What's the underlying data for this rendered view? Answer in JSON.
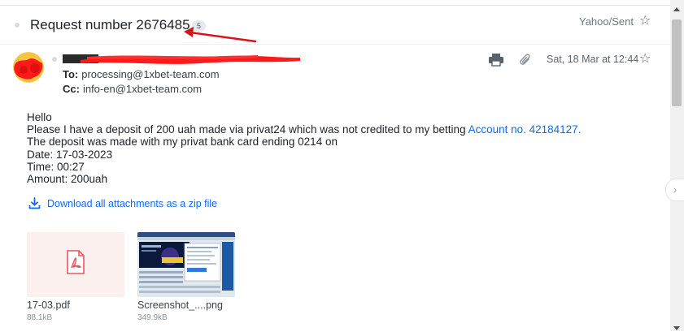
{
  "header": {
    "subject": "Request number 2676485",
    "message_count": "5",
    "folder": "Yahoo/Sent"
  },
  "message": {
    "to_label": "To:",
    "to_value": "processing@1xbet-team.com",
    "cc_label": "Cc:",
    "cc_value": "info-en@1xbet-team.com",
    "date": "Sat, 18 Mar at 12:44",
    "body": {
      "greeting": "Hello",
      "line1_prefix": "Please I have a deposit of 200 uah made via privat24 which was not credited to my betting ",
      "line1_link": "Account no. 42184127.",
      "line2": "The deposit was made with my privat bank card ending 0214 on",
      "line3": "Date: 17-03-2023",
      "line4": "Time: 00:27",
      "line5": "Amount: 200uah"
    }
  },
  "attachments": {
    "download_all": "Download all attachments as a zip file",
    "items": [
      {
        "name": "17-03.pdf",
        "size": "88.1kB",
        "icon": "pdf-icon"
      },
      {
        "name": "Screenshot_....png",
        "size": "349.9kB",
        "icon": "image-thumbnail"
      }
    ]
  },
  "colors": {
    "link": "#0f69ff",
    "annotation_arrow": "#d8141b",
    "redaction": "#ff1a1a",
    "pdf_icon": "#e8585c"
  }
}
